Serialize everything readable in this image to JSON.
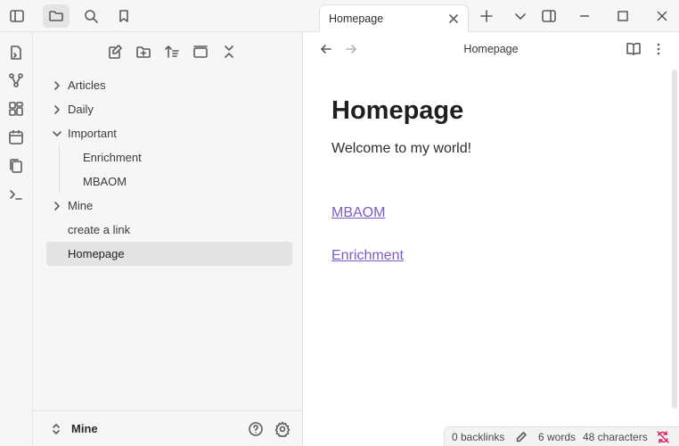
{
  "tab": {
    "title": "Homepage"
  },
  "view_header": {
    "title": "Homepage"
  },
  "file_tree": {
    "items": [
      {
        "label": "Articles",
        "type": "folder",
        "expanded": false
      },
      {
        "label": "Daily",
        "type": "folder",
        "expanded": false
      },
      {
        "label": "Important",
        "type": "folder",
        "expanded": true
      },
      {
        "label": "Enrichment",
        "type": "file",
        "parent": "Important"
      },
      {
        "label": "MBAOM",
        "type": "file",
        "parent": "Important"
      },
      {
        "label": "Mine",
        "type": "folder",
        "expanded": false
      },
      {
        "label": "create a link",
        "type": "file"
      },
      {
        "label": "Homepage",
        "type": "file",
        "selected": true
      }
    ]
  },
  "vault": {
    "name": "Mine"
  },
  "note": {
    "heading": "Homepage",
    "paragraph": "Welcome to my world!",
    "links": [
      "MBAOM",
      "Enrichment"
    ]
  },
  "status_bar": {
    "backlinks": "0 backlinks",
    "words": "6 words",
    "characters": "48 characters"
  },
  "colors": {
    "link": "#7b5cc8",
    "sync_error": "#e0245e",
    "sidebar_bg": "#f6f6f6"
  }
}
